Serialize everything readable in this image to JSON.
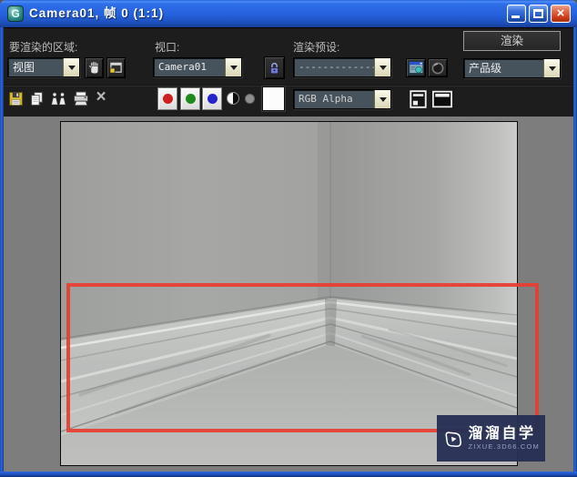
{
  "window": {
    "title": "Camera01, 帧 0 (1:1)"
  },
  "toolbar": {
    "area_label": "要渲染的区域:",
    "area_value": "视图",
    "viewport_label": "视口:",
    "viewport_value": "Camera01",
    "preset_label": "渲染预设:",
    "preset_value": "---------------",
    "render_label": "渲染",
    "mode_value": "产品级",
    "channel_value": "RGB Alpha"
  },
  "watermark": {
    "brand": "溜溜自学",
    "site": "zixue.3d66.com"
  },
  "glyphs": {
    "close": "×",
    "clear": "×",
    "window_icon": "G"
  },
  "colors": {
    "titlebar_blue": "#2561dd",
    "toolbar_bg": "#1d1d1d",
    "canvas_gray": "#7d7d7d",
    "region_red": "#e73e32",
    "watermark_navy": "#273054",
    "combo_field": "#46535c",
    "arrow_cream": "#f2eed6"
  },
  "icons": {
    "window-icon": "teal-sphere-G",
    "minimize-icon": "white-bar",
    "maximize-icon": "white-square",
    "close-icon": "white-x",
    "pan-icon": "hand",
    "edit-region-icon": "region-frame",
    "lock-icon": "padlock",
    "render-setup-icon": "dialog-window",
    "environment-icon": "dark-ring",
    "save-icon": "floppy-disk",
    "copy-icon": "two-pages",
    "clone-icon": "two-figures",
    "print-icon": "printer",
    "clear-icon": "x-mark",
    "red-channel-icon": "red-dot",
    "green-channel-icon": "green-dot",
    "blue-channel-icon": "blue-dot",
    "monochrome-icon": "half-circle",
    "alpha-icon": "gray-dot",
    "color-swatch-icon": "white-square",
    "layers-icon": "stacked-window",
    "viewport-overlay-icon": "dark-frame"
  }
}
